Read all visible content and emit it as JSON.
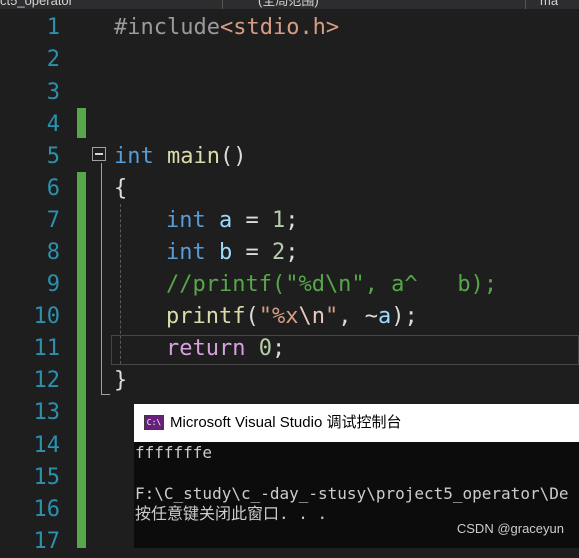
{
  "tabs": {
    "project": "ct5_operator",
    "scope": "(全局范围)",
    "member": "ma"
  },
  "line_numbers": [
    "1",
    "2",
    "3",
    "4",
    "5",
    "6",
    "7",
    "8",
    "9",
    "10",
    "11",
    "12",
    "13",
    "14",
    "15",
    "16",
    "17"
  ],
  "code": {
    "line1": {
      "directive": "#include",
      "header": "<stdio.h>"
    },
    "line5": {
      "type": "int",
      "name": "main",
      "parens": "()"
    },
    "line6": {
      "brace": "{"
    },
    "line7": {
      "type": "int",
      "var": "a",
      "op": " = ",
      "num": "1",
      "end": ";"
    },
    "line8": {
      "type": "int",
      "var": "b",
      "op": " = ",
      "num": "2",
      "end": ";"
    },
    "line9": {
      "comment": "//printf(\"%d\\n\", a^   b);"
    },
    "line10": {
      "fn": "printf",
      "open": "(",
      "str1": "\"%x",
      "esc": "\\n",
      "str2": "\"",
      "rest1": ", ~",
      "var": "a",
      "rest2": ");"
    },
    "line11": {
      "keyword": "return",
      "num": "0",
      "end": ";"
    },
    "line12": {
      "brace": "}"
    }
  },
  "console": {
    "icon_text": "C:\\",
    "title": "Microsoft Visual Studio 调试控制台",
    "output": "fffffffe",
    "path": "F:\\C_study\\c_-day_-stusy\\project5_operator\\De",
    "prompt": "按任意键关闭此窗口. . ."
  },
  "watermark": "CSDN @graceyun",
  "colors": {
    "background": "#1e1e1e",
    "line_number": "#2b91af",
    "keyword": "#569cd6",
    "string": "#d69d85",
    "comment": "#57a64a",
    "function": "#dcdcaa",
    "variable": "#9cdcfe",
    "number": "#b5cea8",
    "control": "#d8a0df",
    "change_bar": "#57a64a"
  }
}
